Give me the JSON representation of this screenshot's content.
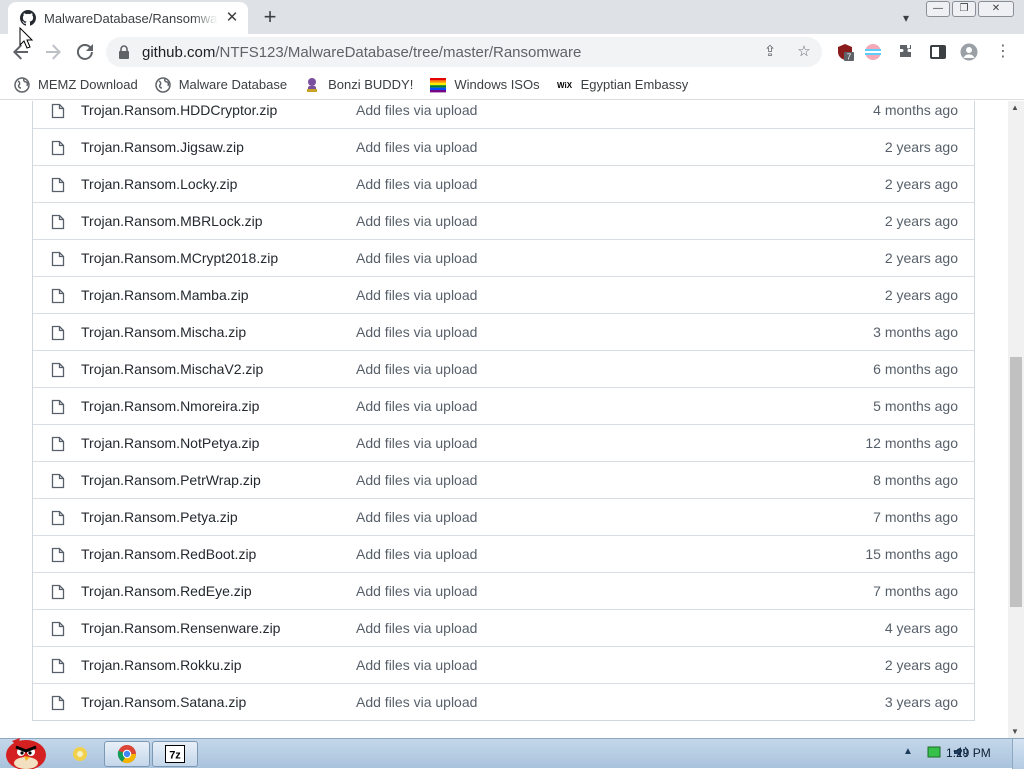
{
  "browser": {
    "tab": {
      "title": "MalwareDatabase/Ransomware",
      "favicon": "github-icon"
    },
    "omnibox": {
      "domain": "github.com",
      "path": "/NTFS123/MalwareDatabase/tree/master/Ransomware"
    },
    "extension_badge": "7",
    "bookmarks": [
      {
        "label": "MEMZ Download",
        "icon": "globe-icon"
      },
      {
        "label": "Malware Database",
        "icon": "globe-icon"
      },
      {
        "label": "Bonzi BUDDY!",
        "icon": "bonzi-icon"
      },
      {
        "label": "Windows ISOs",
        "icon": "rainbow-flag-icon"
      },
      {
        "label": "Egyptian Embassy",
        "icon": "wix-icon"
      }
    ]
  },
  "files": [
    {
      "name": "Trojan.Ransom.HDDCryptor.zip",
      "message": "Add files via upload",
      "age": "4 months ago"
    },
    {
      "name": "Trojan.Ransom.Jigsaw.zip",
      "message": "Add files via upload",
      "age": "2 years ago"
    },
    {
      "name": "Trojan.Ransom.Locky.zip",
      "message": "Add files via upload",
      "age": "2 years ago"
    },
    {
      "name": "Trojan.Ransom.MBRLock.zip",
      "message": "Add files via upload",
      "age": "2 years ago"
    },
    {
      "name": "Trojan.Ransom.MCrypt2018.zip",
      "message": "Add files via upload",
      "age": "2 years ago"
    },
    {
      "name": "Trojan.Ransom.Mamba.zip",
      "message": "Add files via upload",
      "age": "2 years ago"
    },
    {
      "name": "Trojan.Ransom.Mischa.zip",
      "message": "Add files via upload",
      "age": "3 months ago"
    },
    {
      "name": "Trojan.Ransom.MischaV2.zip",
      "message": "Add files via upload",
      "age": "6 months ago"
    },
    {
      "name": "Trojan.Ransom.Nmoreira.zip",
      "message": "Add files via upload",
      "age": "5 months ago"
    },
    {
      "name": "Trojan.Ransom.NotPetya.zip",
      "message": "Add files via upload",
      "age": "12 months ago"
    },
    {
      "name": "Trojan.Ransom.PetrWrap.zip",
      "message": "Add files via upload",
      "age": "8 months ago"
    },
    {
      "name": "Trojan.Ransom.Petya.zip",
      "message": "Add files via upload",
      "age": "7 months ago"
    },
    {
      "name": "Trojan.Ransom.RedBoot.zip",
      "message": "Add files via upload",
      "age": "15 months ago"
    },
    {
      "name": "Trojan.Ransom.RedEye.zip",
      "message": "Add files via upload",
      "age": "7 months ago"
    },
    {
      "name": "Trojan.Ransom.Rensenware.zip",
      "message": "Add files via upload",
      "age": "4 years ago"
    },
    {
      "name": "Trojan.Ransom.Rokku.zip",
      "message": "Add files via upload",
      "age": "2 years ago"
    },
    {
      "name": "Trojan.Ransom.Satana.zip",
      "message": "Add files via upload",
      "age": "3 years ago"
    }
  ],
  "taskbar": {
    "clock": "1:29 PM",
    "pinned": [
      "chrome-icon",
      "7zip-icon"
    ],
    "sevenzip_label": "7z"
  },
  "colors": {
    "link": "#24292f",
    "muted": "#57606a",
    "border": "#d0d7de",
    "tabstrip": "#dee1e6",
    "taskbar": "#b4cbe2"
  }
}
